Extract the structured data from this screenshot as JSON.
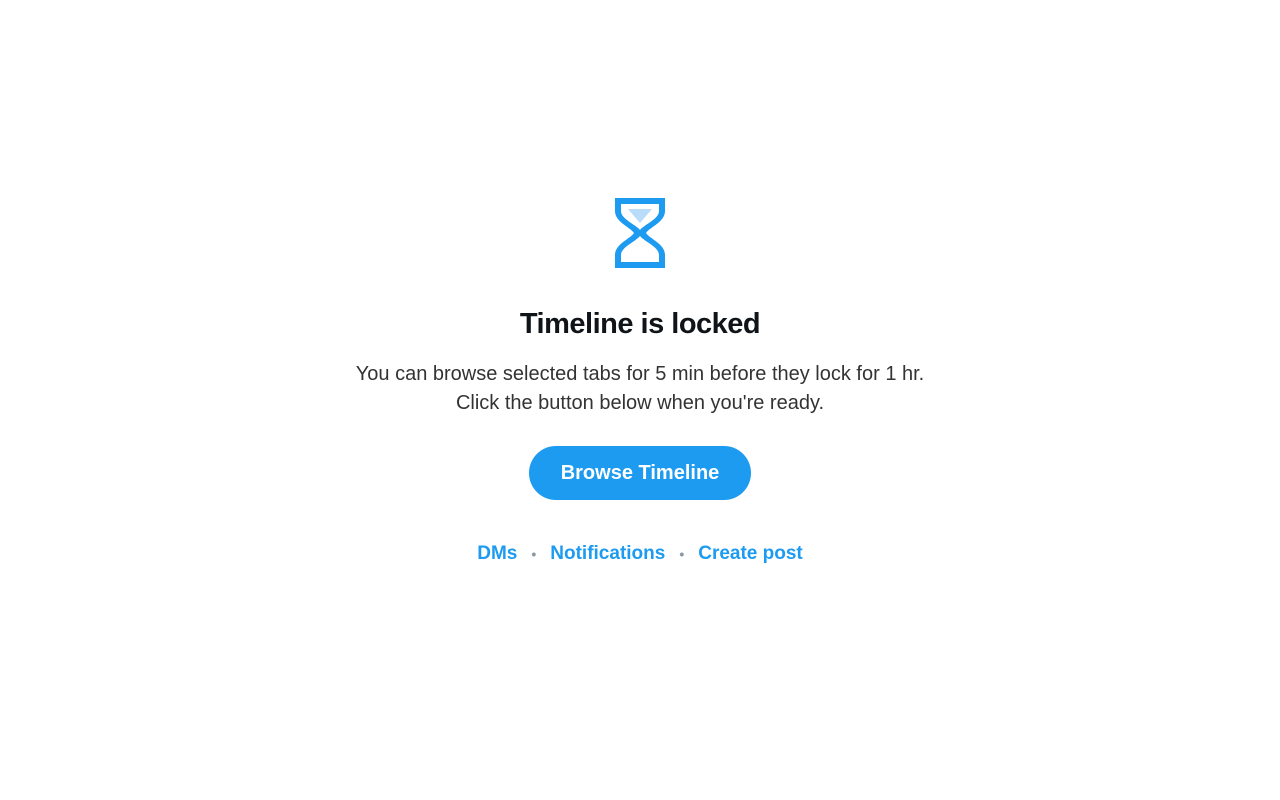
{
  "lock_screen": {
    "icon": "hourglass-icon",
    "title": "Timeline is locked",
    "description_line1": "You can browse selected tabs for 5 min before they lock for 1 hr.",
    "description_line2": "Click the button below when you're ready.",
    "button_label": "Browse Timeline",
    "links": {
      "dms": "DMs",
      "notifications": "Notifications",
      "create_post": "Create post"
    },
    "separator": "•"
  },
  "colors": {
    "accent": "#1d9bf0",
    "accent_light": "#b9dcfa",
    "title": "#0f1419",
    "body_text": "#333333",
    "separator": "#8b98a5",
    "background": "#ffffff"
  }
}
